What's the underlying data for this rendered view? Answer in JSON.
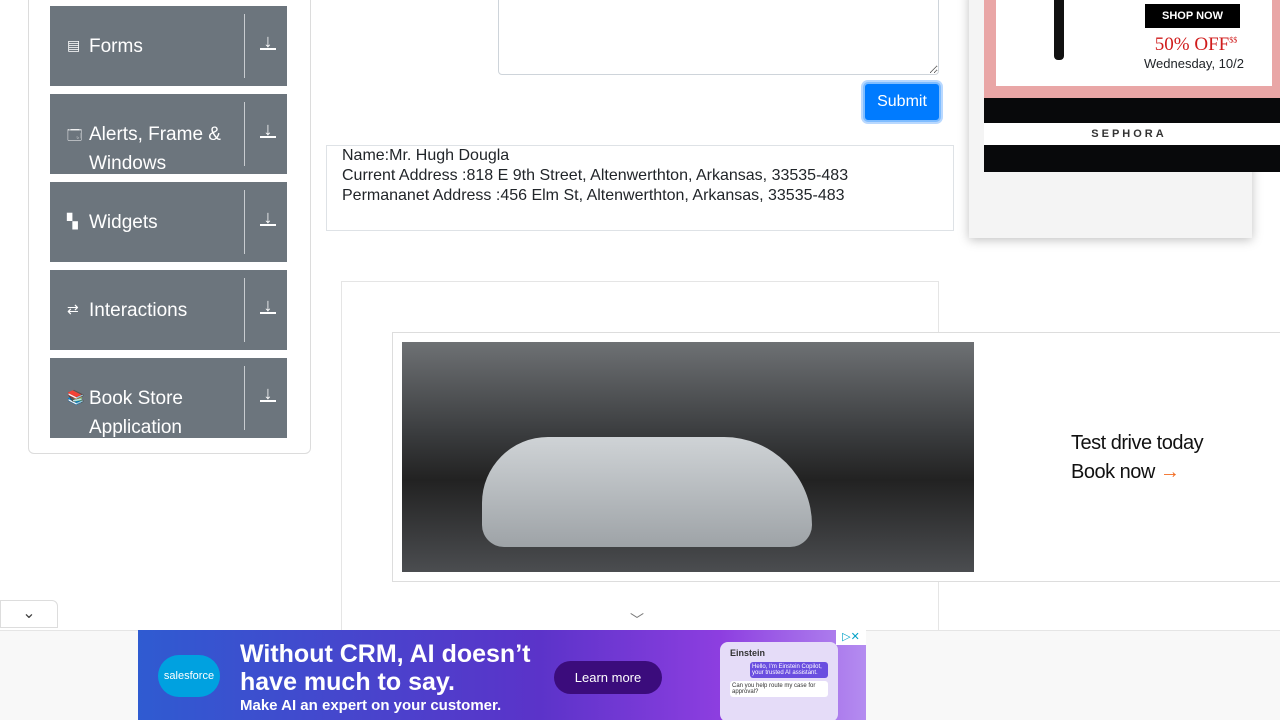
{
  "sidebar": {
    "groups": [
      {
        "label": "Forms",
        "icon": "form-icon"
      },
      {
        "label": "Alerts, Frame & Windows",
        "icon": "window-icon"
      },
      {
        "label": "Widgets",
        "icon": "widgets-icon"
      },
      {
        "label": "Interactions",
        "icon": "interactions-icon"
      },
      {
        "label": "Book Store Application",
        "icon": "books-icon"
      }
    ]
  },
  "form": {
    "submit_label": "Submit"
  },
  "output": {
    "name": "Name:Mr. Hugh Dougla",
    "current_address": "Current Address :818 E 9th Street, Altenwerthton, Arkansas, 33535-483",
    "permanent_address": "Permananet Address :456 Elm St, Altenwerthton, Arkansas, 33535-483"
  },
  "car_ad": {
    "line1": "Test drive today",
    "line2": "Book now"
  },
  "sephora_ad": {
    "shop": "SHOP NOW",
    "offer": "50% OFF",
    "offer_sup": "$$",
    "date": "Wednesday, 10/2",
    "brand": "SEPHORA"
  },
  "salesforce_ad": {
    "logo": "salesforce",
    "headline1": "Without CRM, AI doesn’t",
    "headline2": "have much to say.",
    "sub": "Make AI an expert on your customer.",
    "cta": "Learn more",
    "card_title": "Einstein",
    "card_msg": "Hello, I'm Einstein Copilot, your trusted AI assistant.",
    "card_q": "Can you help route my case for approval?"
  }
}
